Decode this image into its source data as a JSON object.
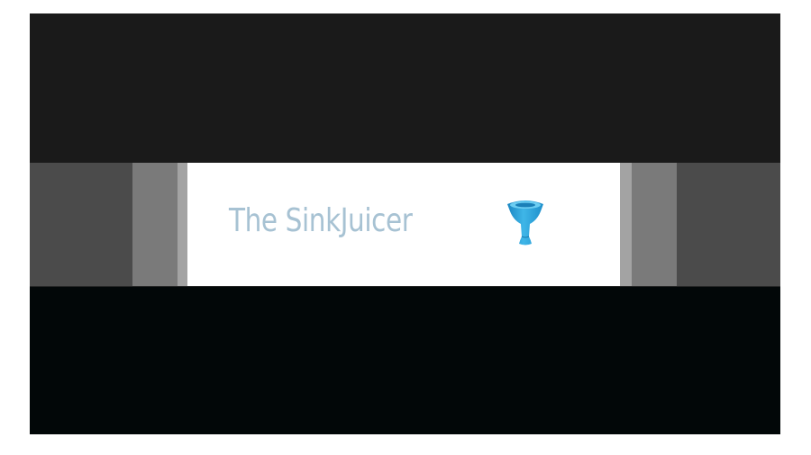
{
  "banner": {
    "title": "The SinkJuicer",
    "title_color": "#a7c2d3",
    "logo_icon": "blue-funnel-icon",
    "logo_color": "#2aa3d8"
  },
  "colors": {
    "top_band": "#1a1a1a",
    "middle_band": "#4b4b4b",
    "bottom_band": "#020708",
    "bar_mid": "#7a7a7a",
    "bar_light": "#a3a3a3"
  }
}
